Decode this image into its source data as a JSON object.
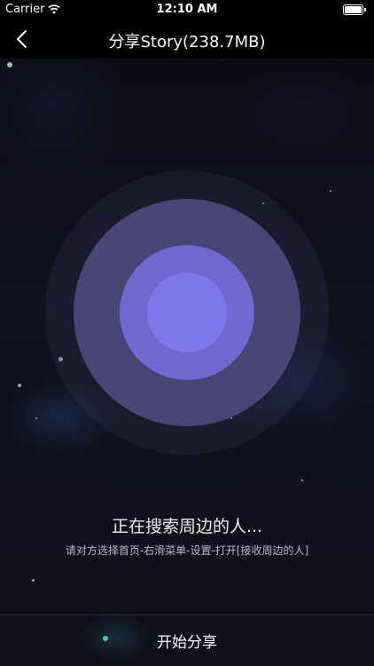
{
  "status_bar": {
    "carrier": "Carrier",
    "time": "12:10 AM"
  },
  "nav": {
    "title": "分享Story(238.7MB)"
  },
  "main": {
    "searching": "正在搜索周边的人...",
    "hint": "请对方选择首页-右滑菜单-设置-打开[接收周边的人]"
  },
  "footer": {
    "start_label": "开始分享"
  },
  "colors": {
    "ring_outer": "#474675",
    "ring_inner": "#6e68cf",
    "ring_core": "#7f78ec",
    "background": "#0d0d14"
  }
}
